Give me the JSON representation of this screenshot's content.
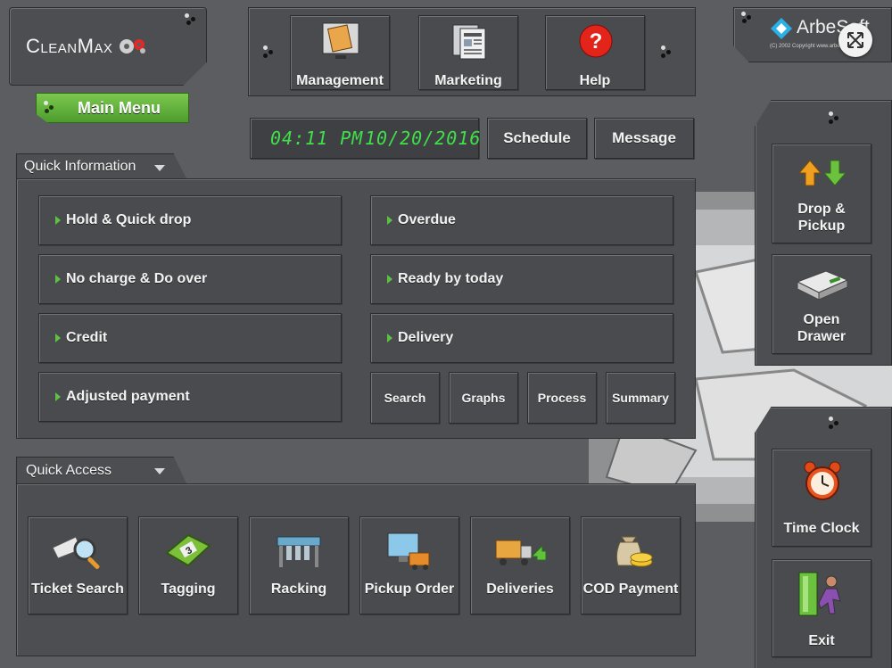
{
  "brand": {
    "name": "CleanMax",
    "vendor": "ArbeSoft",
    "vendor_fine_print": "(C) 2002 Copyright www.arbesoft.com"
  },
  "top_toolbar": [
    {
      "key": "management",
      "label": "Management",
      "icon": "ledger-book-icon"
    },
    {
      "key": "marketing",
      "label": "Marketing",
      "icon": "newsletter-icon"
    },
    {
      "key": "help",
      "label": "Help",
      "icon": "help-question-icon"
    }
  ],
  "main_menu": {
    "label": "Main Menu"
  },
  "clock": {
    "time": "04:11 PM",
    "date": "10/20/2016"
  },
  "header_buttons": {
    "schedule": "Schedule",
    "message": "Message"
  },
  "quick_information": {
    "title": "Quick Information",
    "left_items": [
      "Hold & Quick drop",
      "No charge & Do over",
      "Credit",
      "Adjusted payment"
    ],
    "right_items": [
      "Overdue",
      "Ready by today",
      "Delivery"
    ],
    "small_buttons": [
      "Search",
      "Graphs",
      "Process",
      "Summary"
    ]
  },
  "quick_access": {
    "title": "Quick Access",
    "items": [
      {
        "label": "Ticket Search",
        "icon": "magnifier-ticket-icon"
      },
      {
        "label": "Tagging",
        "icon": "tag-icon"
      },
      {
        "label": "Racking",
        "icon": "rack-icon"
      },
      {
        "label": "Pickup Order",
        "icon": "pickup-order-icon"
      },
      {
        "label": "Deliveries",
        "icon": "delivery-truck-icon"
      },
      {
        "label": "COD Payment",
        "icon": "money-bag-icon"
      }
    ]
  },
  "side_panel_top": [
    {
      "label_line1": "Drop &",
      "label_line2": "Pickup",
      "icon": "up-down-arrows-icon"
    },
    {
      "label_line1": "Open",
      "label_line2": "Drawer",
      "icon": "cash-drawer-icon"
    }
  ],
  "side_panel_bottom": [
    {
      "label": "Time Clock",
      "icon": "alarm-clock-icon"
    },
    {
      "label": "Exit",
      "icon": "exit-door-icon"
    }
  ],
  "colors": {
    "accent_green": "#5fc23f",
    "clock_digits": "#3fe04a",
    "help_red": "#e3241b",
    "panel": "#4d4e51",
    "background": "#5b5d60"
  }
}
